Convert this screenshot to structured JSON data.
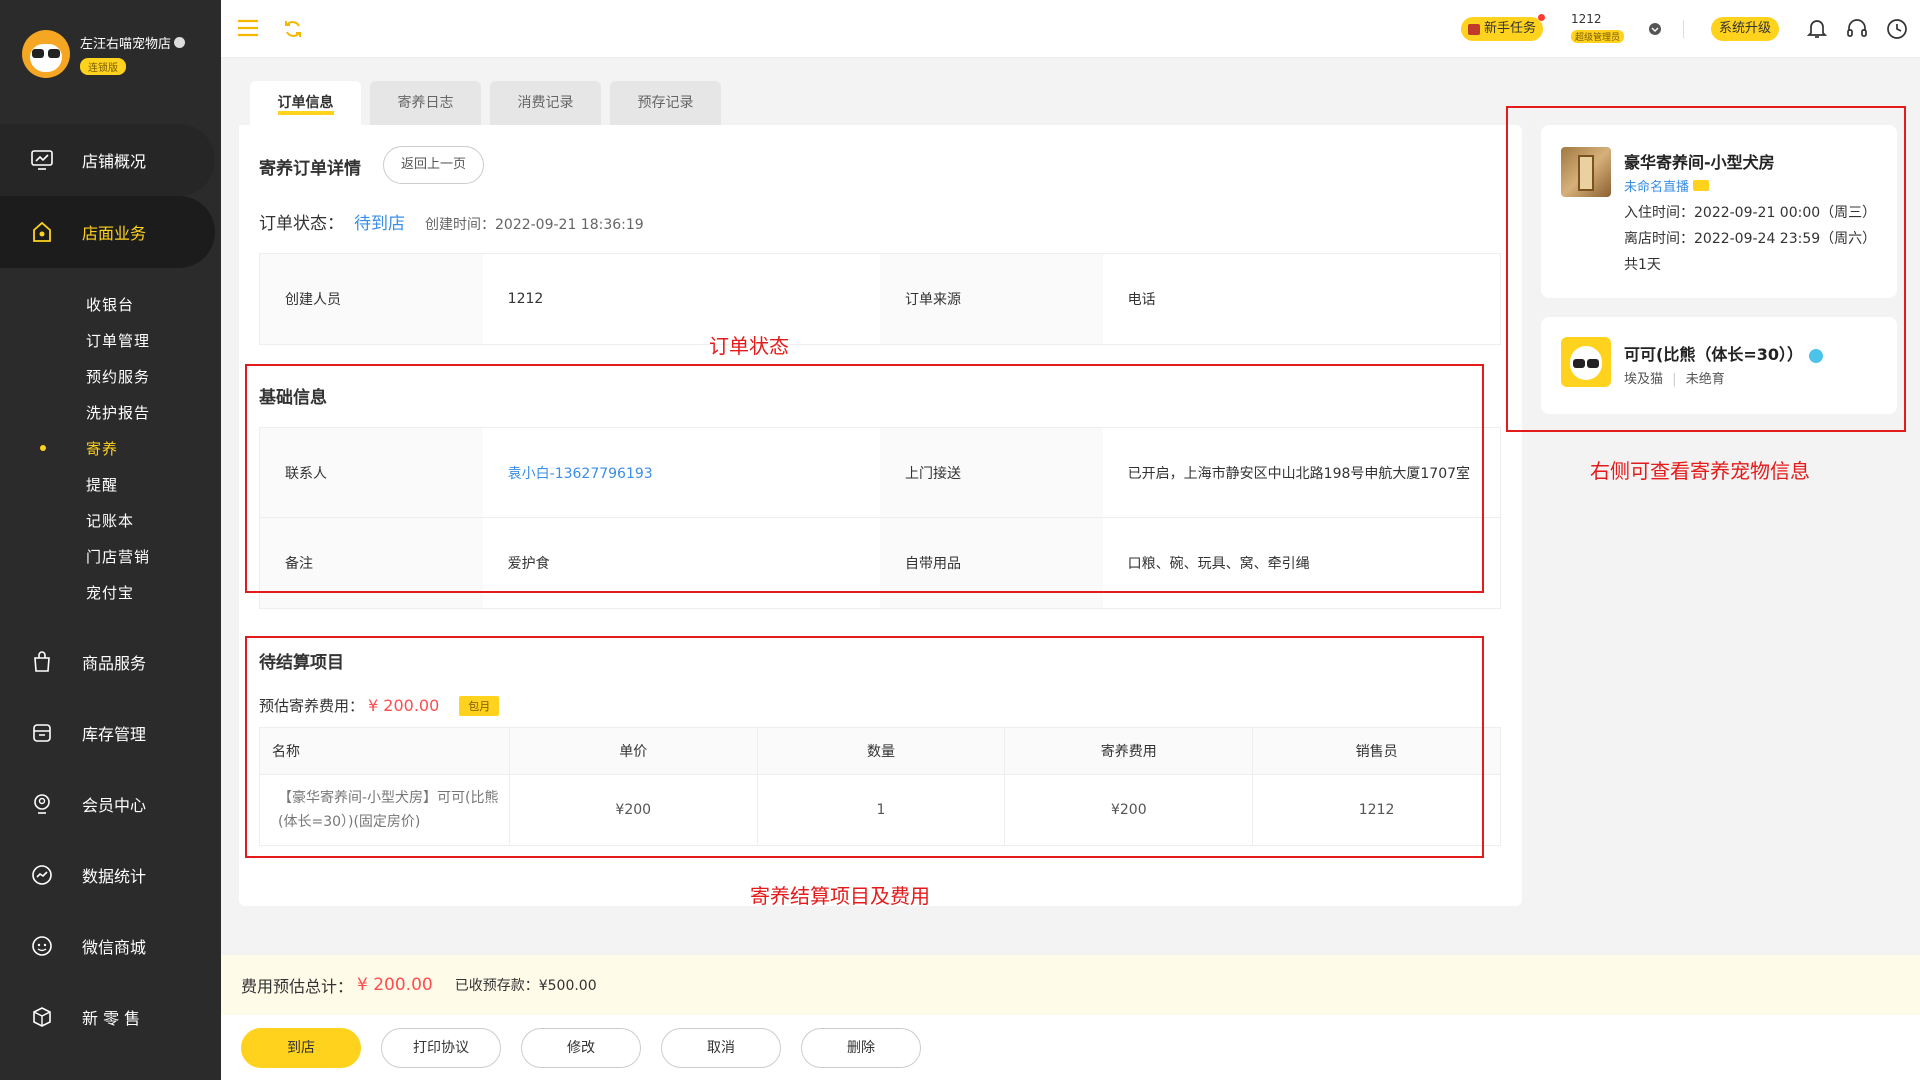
{
  "store": {
    "name": "左汪右喵宠物店",
    "tag": "连锁版"
  },
  "nav": [
    {
      "label": "店铺概况",
      "icon": "dashboard-icon"
    },
    {
      "label": "店面业务",
      "icon": "store-icon"
    },
    {
      "label": "商品服务",
      "icon": "goods-icon"
    },
    {
      "label": "库存管理",
      "icon": "inventory-icon"
    },
    {
      "label": "会员中心",
      "icon": "member-icon"
    },
    {
      "label": "数据统计",
      "icon": "stats-icon"
    },
    {
      "label": "微信商城",
      "icon": "wechat-icon"
    },
    {
      "label": "新 零 售",
      "icon": "retail-icon"
    }
  ],
  "subnav": [
    "收银台",
    "订单管理",
    "预约服务",
    "洗护报告",
    "寄养",
    "提醒",
    "记账本",
    "门店营销",
    "宠付宝"
  ],
  "topbar": {
    "task_label": "新手任务",
    "user_name": "1212",
    "user_role": "超级管理员",
    "upgrade_label": "系统升级"
  },
  "tabs": [
    "订单信息",
    "寄养日志",
    "消费记录",
    "预存记录"
  ],
  "detail": {
    "title": "寄养订单详情",
    "back_label": "返回上一页",
    "status_label": "订单状态：",
    "status_value": "待到店",
    "created": "创建时间：2022-09-21 18:36:19",
    "creator_label": "创建人员",
    "creator_value": "1212",
    "source_label": "订单来源",
    "source_value": "电话"
  },
  "basic": {
    "title": "基础信息",
    "contact_label": "联系人",
    "contact_value": "袁小白-13627796193",
    "pickup_label": "上门接送",
    "pickup_value": "已开启，上海市静安区中山北路198号申航大厦1707室",
    "remark_label": "备注",
    "remark_value": "爱护食",
    "supplies_label": "自带用品",
    "supplies_value": "口粮、碗、玩具、窝、牵引绳"
  },
  "settle": {
    "title": "待结算项目",
    "fee_label": "预估寄养费用：",
    "fee_value": "¥ 200.00",
    "fee_tag": "包月",
    "headers": [
      "名称",
      "单价",
      "数量",
      "寄养费用",
      "销售员"
    ],
    "row": {
      "name_line1": "【豪华寄养间-小型犬房】可可(比熊",
      "name_line2": "(体长=30）)(固定房价)",
      "price": "¥200",
      "qty": "1",
      "fee": "¥200",
      "seller": "1212"
    }
  },
  "room": {
    "title": "豪华寄养间-小型犬房",
    "live": "未命名直播",
    "checkin": "入住时间：2022-09-21 00:00（周三）",
    "checkout": "离店时间：2022-09-24 23:59（周六）",
    "days": "共1天"
  },
  "pet": {
    "name": "可可(比熊（体长=30））",
    "breed": "埃及猫",
    "neuter": "未绝育"
  },
  "bottom": {
    "total_label": "费用预估总计：",
    "total_value": "¥ 200.00",
    "prepaid": "已收预存款：¥500.00",
    "buttons": [
      "到店",
      "打印协议",
      "修改",
      "取消",
      "删除"
    ]
  },
  "annotations": {
    "status_note": "订单状态",
    "pet_note": "右侧可查看寄养宠物信息",
    "settle_note": "寄养结算项目及费用"
  }
}
